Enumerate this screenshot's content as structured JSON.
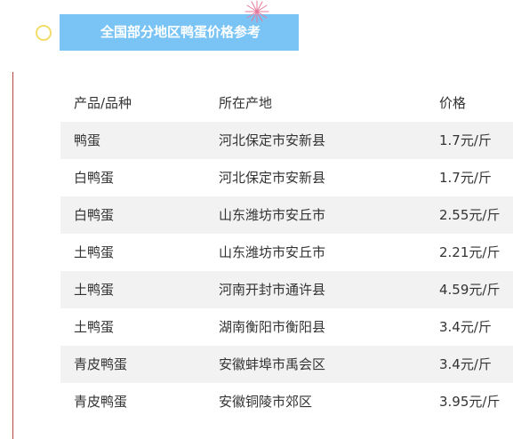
{
  "title": "全国部分地区鸭蛋价格参考",
  "colors": {
    "banner": "#79c4f5",
    "circle": "#f3dd6a",
    "burst": "#e8789a",
    "left_line": "#b04646",
    "row_shade": "#f2f2f2"
  },
  "table": {
    "headers": [
      "产品/品种",
      "所在产地",
      "价格"
    ],
    "rows": [
      {
        "product": "鸭蛋",
        "origin": "河北保定市安新县",
        "price": "1.7元/斤"
      },
      {
        "product": "白鸭蛋",
        "origin": "河北保定市安新县",
        "price": "1.7元/斤"
      },
      {
        "product": "白鸭蛋",
        "origin": "山东潍坊市安丘市",
        "price": "2.55元/斤"
      },
      {
        "product": "土鸭蛋",
        "origin": "山东潍坊市安丘市",
        "price": "2.21元/斤"
      },
      {
        "product": "土鸭蛋",
        "origin": "河南开封市通许县",
        "price": "4.59元/斤"
      },
      {
        "product": "土鸭蛋",
        "origin": "湖南衡阳市衡阳县",
        "price": "3.4元/斤"
      },
      {
        "product": "青皮鸭蛋",
        "origin": "安徽蚌埠市禹会区",
        "price": "3.4元/斤"
      },
      {
        "product": "青皮鸭蛋",
        "origin": "安徽铜陵市郊区",
        "price": "3.95元/斤"
      }
    ]
  }
}
